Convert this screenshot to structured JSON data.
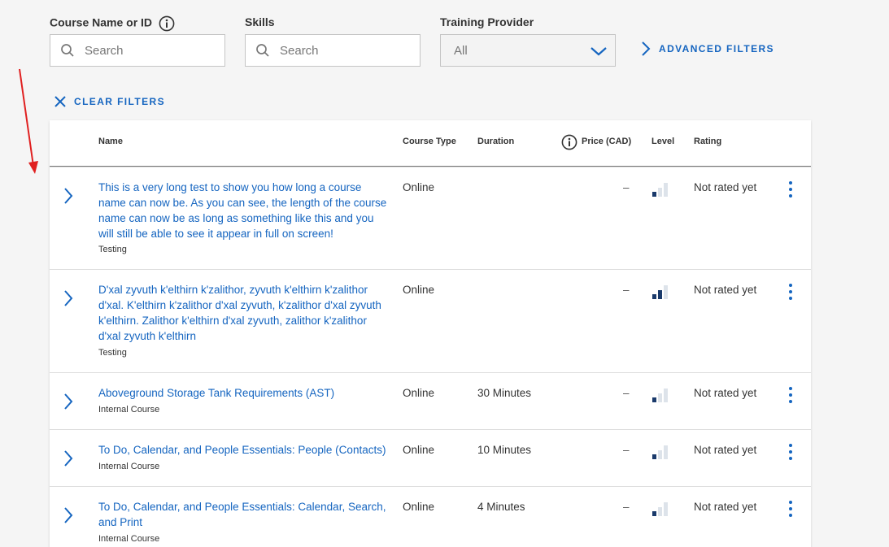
{
  "filters": {
    "course_label": "Course Name or ID",
    "course_placeholder": "Search",
    "skills_label": "Skills",
    "skills_placeholder": "Search",
    "provider_label": "Training Provider",
    "provider_value": "All",
    "advanced_label": "ADVANCED FILTERS",
    "clear_label": "CLEAR FILTERS"
  },
  "table": {
    "headers": {
      "name": "Name",
      "course_type": "Course Type",
      "duration": "Duration",
      "price": "Price (CAD)",
      "level": "Level",
      "rating": "Rating"
    },
    "rows": [
      {
        "name": "This is a very long test to show you how long a course name can now be. As you can see, the length of the course name can now be as long as something like this and you will still be able to see it appear in full on screen!",
        "provider": "Testing",
        "course_type": "Online",
        "duration": "",
        "price": "–",
        "level": 1,
        "rating": "Not rated yet"
      },
      {
        "name": "D'xal zyvuth k'elthirn k'zalithor, zyvuth k'elthirn k'zalithor d'xal. K'elthirn k'zalithor d'xal zyvuth, k'zalithor d'xal zyvuth k'elthirn. Zalithor k'elthirn d'xal zyvuth, zalithor k'zalithor d'xal zyvuth k'elthirn",
        "provider": "Testing",
        "course_type": "Online",
        "duration": "",
        "price": "–",
        "level": 2,
        "rating": "Not rated yet"
      },
      {
        "name": "Aboveground Storage Tank Requirements (AST)",
        "provider": "Internal Course",
        "course_type": "Online",
        "duration": "30 Minutes",
        "price": "–",
        "level": 1,
        "rating": "Not rated yet"
      },
      {
        "name": "To Do, Calendar, and People Essentials: People (Contacts)",
        "provider": "Internal Course",
        "course_type": "Online",
        "duration": "10 Minutes",
        "price": "–",
        "level": 1,
        "rating": "Not rated yet"
      },
      {
        "name": "To Do, Calendar, and People Essentials: Calendar, Search, and Print",
        "provider": "Internal Course",
        "course_type": "Online",
        "duration": "4 Minutes",
        "price": "–",
        "level": 1,
        "rating": "Not rated yet"
      }
    ]
  },
  "colors": {
    "accent": "#1565c0",
    "level_filled": "#1a3a6b",
    "level_empty": "#dde3ea",
    "annotation_arrow": "#e02020"
  }
}
